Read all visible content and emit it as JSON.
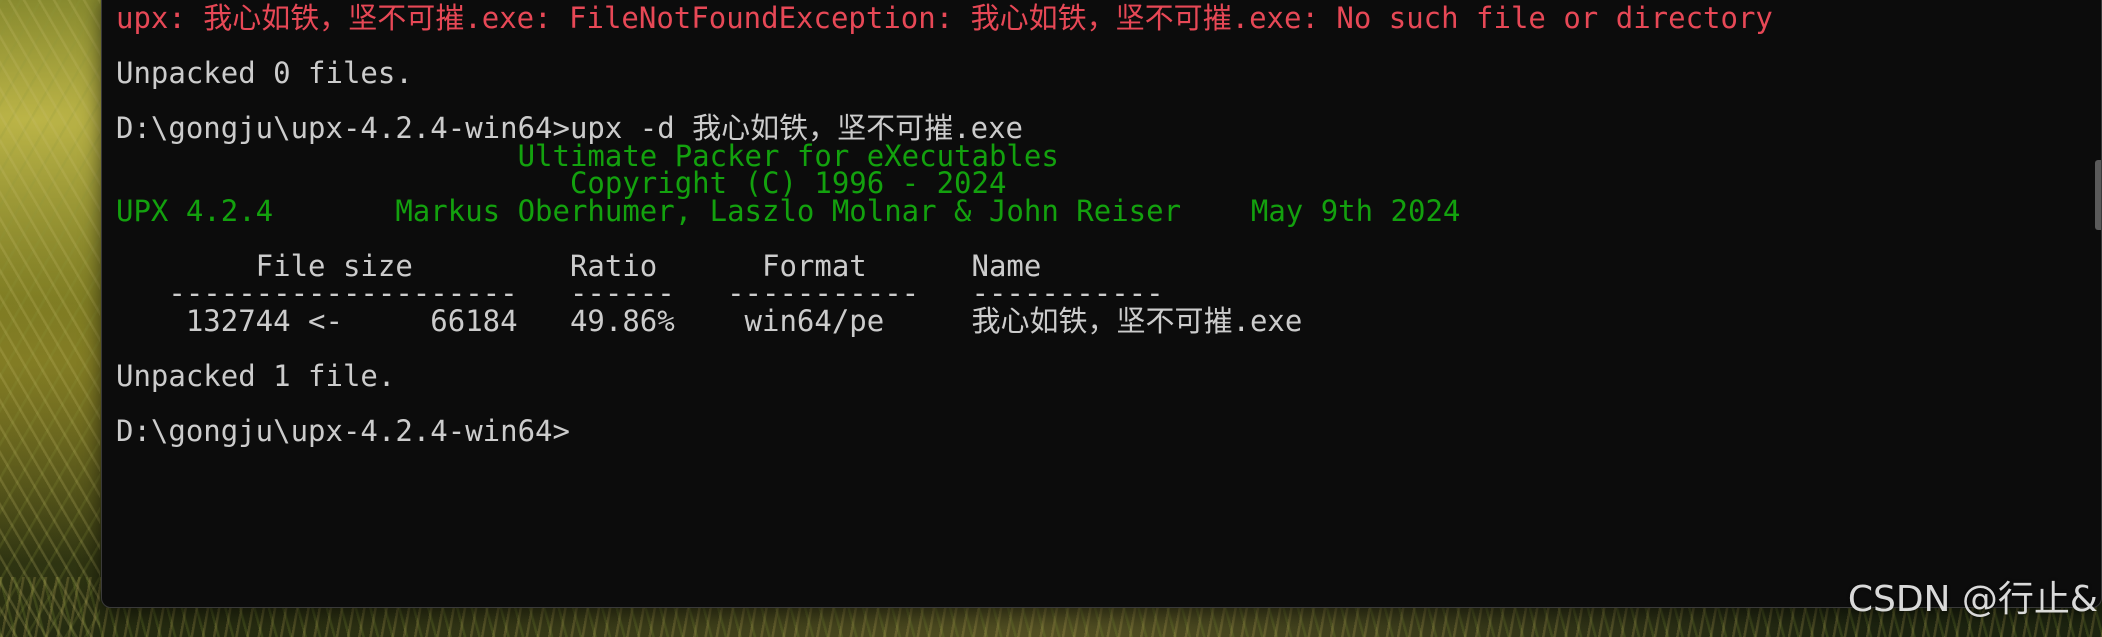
{
  "terminal": {
    "lines": [
      {
        "text": "upx: 我心如铁，坚不可摧.exe: FileNotFoundException: 我心如铁，坚不可摧.exe: No such file or directory"
      },
      {
        "text": "Unpacked 0 files."
      },
      {
        "text": "D:\\gongju\\upx-4.2.4-win64>upx -d 我心如铁，坚不可摧.exe"
      },
      {
        "text": "                       Ultimate Packer for eXecutables"
      },
      {
        "text": "                          Copyright (C) 1996 - 2024"
      },
      {
        "text": "UPX 4.2.4       Markus Oberhumer, Laszlo Molnar & John Reiser    May 9th 2024"
      },
      {
        "text": "        File size         Ratio      Format      Name"
      },
      {
        "text": "   --------------------   ------   -----------   -----------"
      },
      {
        "text": "    132744 <-     66184   49.86%    win64/pe     我心如铁，坚不可摧.exe"
      },
      {
        "text": "Unpacked 1 file."
      },
      {
        "text": "D:\\gongju\\upx-4.2.4-win64>"
      }
    ]
  },
  "watermark": {
    "text": "CSDN @行止&"
  },
  "colors": {
    "error_text": "#e74856",
    "banner_text": "#13a10e",
    "default_text": "#cccccc",
    "background": "#0c0c0c"
  }
}
